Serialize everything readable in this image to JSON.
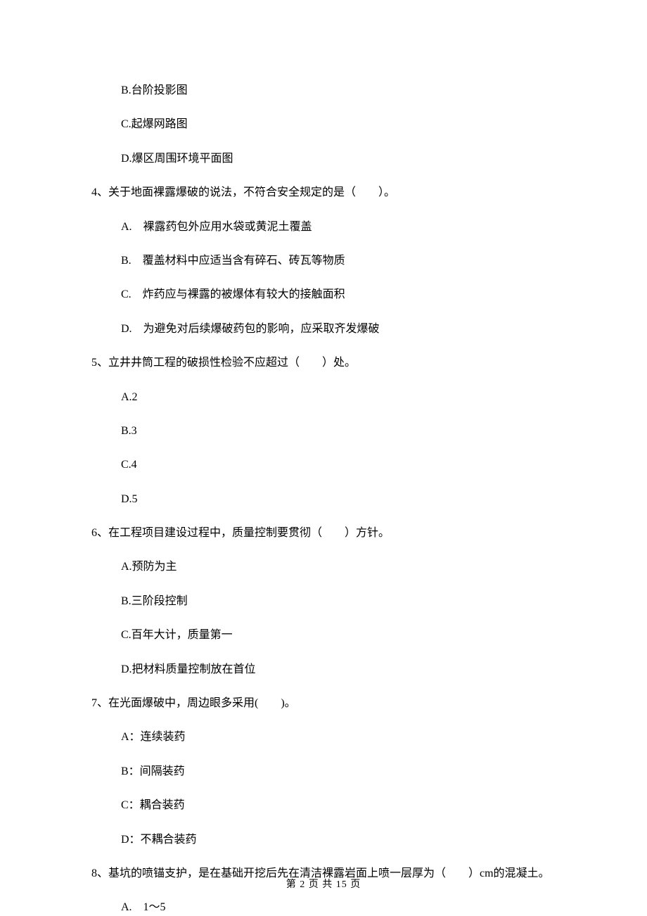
{
  "prev_options": {
    "b": "B.台阶投影图",
    "c": "C.起爆网路图",
    "d": "D.爆区周围环境平面图"
  },
  "q4": {
    "stem": "4、关于地面裸露爆破的说法，不符合安全规定的是（　　）。",
    "a": "A.　裸露药包外应用水袋或黄泥土覆盖",
    "b": "B.　覆盖材料中应适当含有碎石、砖瓦等物质",
    "c": "C.　炸药应与裸露的被爆体有较大的接触面积",
    "d": "D.　为避免对后续爆破药包的影响，应采取齐发爆破"
  },
  "q5": {
    "stem": "5、立井井筒工程的破损性检验不应超过（　　）处。",
    "a": "A.2",
    "b": "B.3",
    "c": "C.4",
    "d": "D.5"
  },
  "q6": {
    "stem": "6、在工程项目建设过程中，质量控制要贯彻（　　）方针。",
    "a": "A.预防为主",
    "b": "B.三阶段控制",
    "c": "C.百年大计，质量第一",
    "d": "D.把材料质量控制放在首位"
  },
  "q7": {
    "stem": "7、在光面爆破中，周边眼多采用(　　)。",
    "a": "A：连续装药",
    "b": "B：间隔装药",
    "c": "C：耦合装药",
    "d": "D：不耦合装药"
  },
  "q8": {
    "stem": "8、基坑的喷锚支护，是在基础开挖后先在清洁裸露岩面上喷一层厚为（　　）cm的混凝土。",
    "a": "A.　1～5"
  },
  "footer": "第 2 页 共 15 页"
}
